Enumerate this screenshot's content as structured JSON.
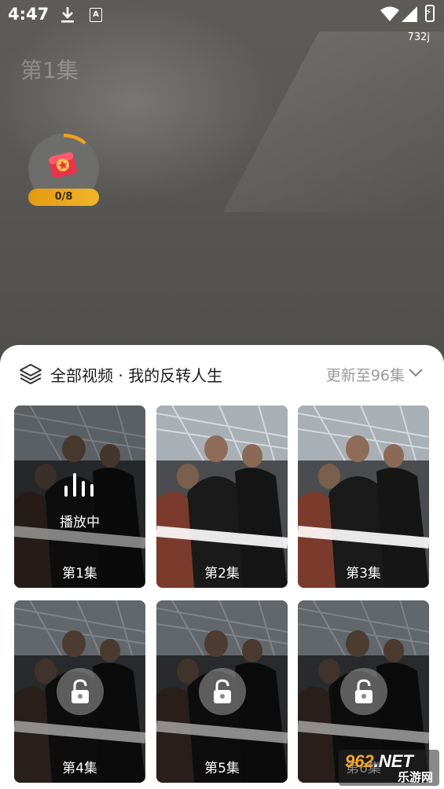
{
  "status_bar": {
    "time": "4:47",
    "net_speed": "732j",
    "icons": [
      "download-icon",
      "a-notification-icon",
      "wifi-icon",
      "signal-icon",
      "battery-charging-icon"
    ]
  },
  "player": {
    "episode_title": "第1集",
    "reward": {
      "progress_text": "0/8",
      "progress": 0.0
    }
  },
  "sheet": {
    "title": "全部视频 · 我的反转人生",
    "update_text": "更新至96集",
    "episodes": [
      {
        "label": "第1集",
        "state": "playing",
        "status_text": "播放中"
      },
      {
        "label": "第2集",
        "state": "available"
      },
      {
        "label": "第3集",
        "state": "available"
      },
      {
        "label": "第4集",
        "state": "locked"
      },
      {
        "label": "第5集",
        "state": "locked"
      },
      {
        "label": "第6集",
        "state": "locked"
      }
    ]
  },
  "watermark": {
    "main_prefix": "962",
    "main_suffix": ".NET",
    "sub": "乐游网"
  },
  "colors": {
    "accent": "#f2a31a",
    "sheet_bg": "#ffffff",
    "muted_text": "#9b9b9b"
  }
}
